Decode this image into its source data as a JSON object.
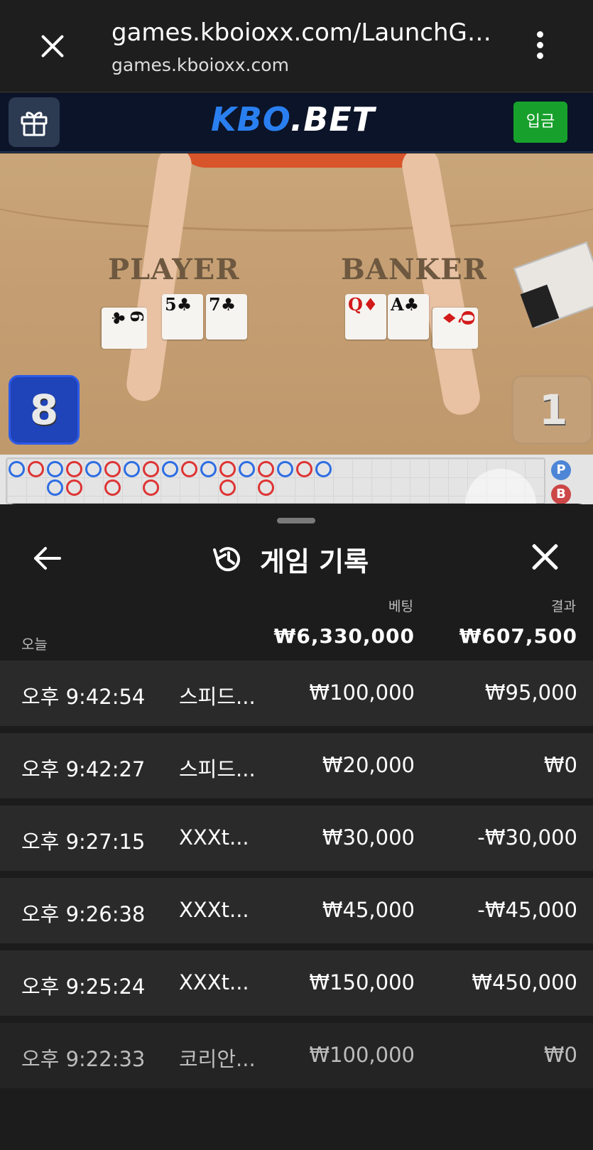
{
  "browser": {
    "url_title": "games.kboioxx.com/LaunchG…",
    "url_domain": "games.kboioxx.com"
  },
  "site": {
    "logo_kbo": "KBO",
    "logo_bet": ".BET",
    "deposit_label": "입금"
  },
  "game": {
    "player_label": "PLAYER",
    "banker_label": "BANKER",
    "player_score": "8",
    "banker_score": "1",
    "player_cards": [
      {
        "rank": "6",
        "suit": "♣",
        "color": "black"
      },
      {
        "rank": "5",
        "suit": "♣",
        "color": "black"
      },
      {
        "rank": "7",
        "suit": "♣",
        "color": "black"
      }
    ],
    "banker_cards": [
      {
        "rank": "Q",
        "suit": "♦",
        "color": "red"
      },
      {
        "rank": "A",
        "suit": "♣",
        "color": "black"
      },
      {
        "rank": "Q",
        "suit": "♦",
        "color": "red"
      }
    ],
    "road_side": {
      "p": "P",
      "b": "B"
    }
  },
  "sheet": {
    "title": "게임 기록",
    "col_bet": "베팅",
    "col_result": "결과",
    "today_label": "오늘",
    "total_bet": "₩6,330,000",
    "total_result": "₩607,500",
    "rows": [
      {
        "time": "오후 9:42:54",
        "game": "스피드...",
        "bet": "₩100,000",
        "result": "₩95,000"
      },
      {
        "time": "오후 9:42:27",
        "game": "스피드...",
        "bet": "₩20,000",
        "result": "₩0"
      },
      {
        "time": "오후 9:27:15",
        "game": "XXXt...",
        "bet": "₩30,000",
        "result": "-₩30,000"
      },
      {
        "time": "오후 9:26:38",
        "game": "XXXt...",
        "bet": "₩45,000",
        "result": "-₩45,000"
      },
      {
        "time": "오후 9:25:24",
        "game": "XXXt...",
        "bet": "₩150,000",
        "result": "₩450,000"
      },
      {
        "time": "오후 9:22:33",
        "game": "코리안...",
        "bet": "₩100,000",
        "result": "₩0"
      }
    ]
  },
  "colors": {
    "accent_blue": "#2a7ff0",
    "deposit_green": "#17a12c",
    "player_blue": "#1f43b8",
    "banker_red": "#de3434"
  }
}
